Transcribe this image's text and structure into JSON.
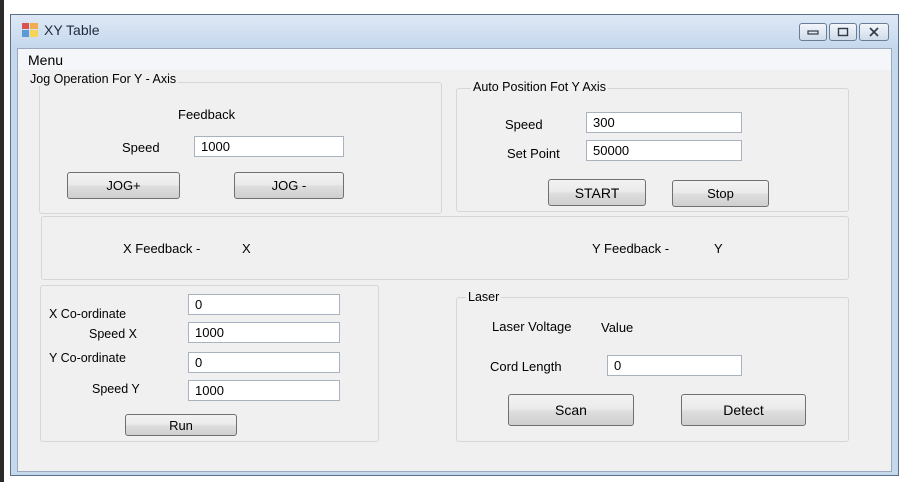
{
  "window": {
    "title": "XY Table",
    "controls": {
      "minimize": "minimize",
      "maximize": "maximize",
      "close": "close"
    }
  },
  "menu": {
    "label": "Menu"
  },
  "jog": {
    "title": "Jog Operation For Y - Axis",
    "feedback_label": "Feedback",
    "speed_label": "Speed",
    "speed_value": "1000",
    "jog_plus_label": "JOG+",
    "jog_minus_label": "JOG -"
  },
  "auto": {
    "title": "Auto Position Fot Y Axis",
    "speed_label": "Speed",
    "speed_value": "300",
    "setpoint_label": "Set Point",
    "setpoint_value": "50000",
    "start_label": "START",
    "stop_label": "Stop"
  },
  "feedback_panel": {
    "x_label": "X Feedback -",
    "x_value": "X",
    "y_label": "Y Feedback -",
    "y_value": "Y"
  },
  "coords": {
    "x_coord_label": "X Co-ordinate",
    "x_coord_value": "0",
    "speed_x_label": "Speed X",
    "speed_x_value": "1000",
    "y_coord_label": "Y Co-ordinate",
    "y_coord_value": "0",
    "speed_y_label": "Speed Y",
    "speed_y_value": "1000",
    "run_label": "Run"
  },
  "laser": {
    "title": "Laser",
    "voltage_label": "Laser Voltage",
    "voltage_value": "Value",
    "cord_label": "Cord Length",
    "cord_value": "0",
    "scan_label": "Scan",
    "detect_label": "Detect"
  },
  "colors": {
    "titlebar": "#c8daee",
    "client": "#f0f0f0",
    "frame": "#c5d8ec"
  },
  "icons": [
    "app-icon",
    "minimize-icon",
    "maximize-icon",
    "close-icon"
  ]
}
